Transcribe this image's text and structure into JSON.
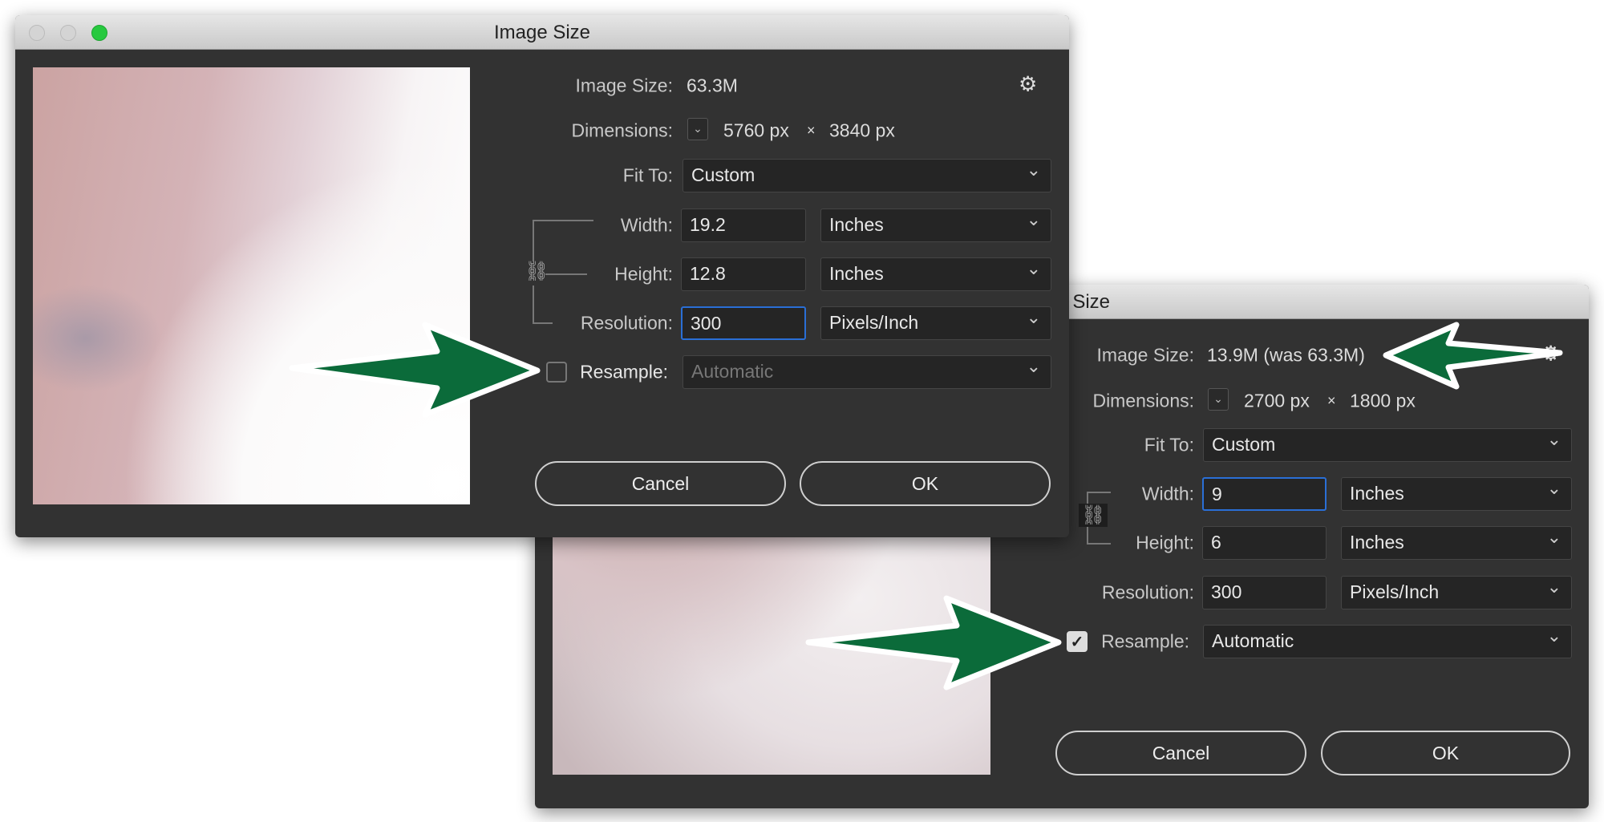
{
  "back_dialog": {
    "title": "Image Size",
    "image_size_label": "Image Size:",
    "image_size_value": "13.9M (was 63.3M)",
    "dimensions_label": "Dimensions:",
    "dim_w": "2700 px",
    "dim_x": "×",
    "dim_h": "1800 px",
    "fit_label": "Fit To:",
    "fit_value": "Custom",
    "width_label": "Width:",
    "width_value": "9",
    "width_unit": "Inches",
    "height_label": "Height:",
    "height_value": "6",
    "height_unit": "Inches",
    "res_label": "Resolution:",
    "res_value": "300",
    "res_unit": "Pixels/Inch",
    "resample_label": "Resample:",
    "resample_checked": true,
    "resample_value": "Automatic",
    "cancel": "Cancel",
    "ok": "OK"
  },
  "front_dialog": {
    "title": "Image Size",
    "image_size_label": "Image Size:",
    "image_size_value": "63.3M",
    "dimensions_label": "Dimensions:",
    "dim_w": "5760 px",
    "dim_x": "×",
    "dim_h": "3840 px",
    "fit_label": "Fit To:",
    "fit_value": "Custom",
    "width_label": "Width:",
    "width_value": "19.2",
    "width_unit": "Inches",
    "height_label": "Height:",
    "height_value": "12.8",
    "height_unit": "Inches",
    "res_label": "Resolution:",
    "res_value": "300",
    "res_unit": "Pixels/Inch",
    "resample_label": "Resample:",
    "resample_checked": false,
    "resample_value": "Automatic",
    "cancel": "Cancel",
    "ok": "OK"
  },
  "icons": {
    "gear": "gear-icon",
    "chain": "link-icon",
    "checkmark": "✓",
    "chevron": "chevron-down-icon"
  },
  "colors": {
    "arrow": "#0b6b3a",
    "dialog_bg": "#323232",
    "focus": "#2a6fd6",
    "zoom_light": "#27c93f"
  }
}
